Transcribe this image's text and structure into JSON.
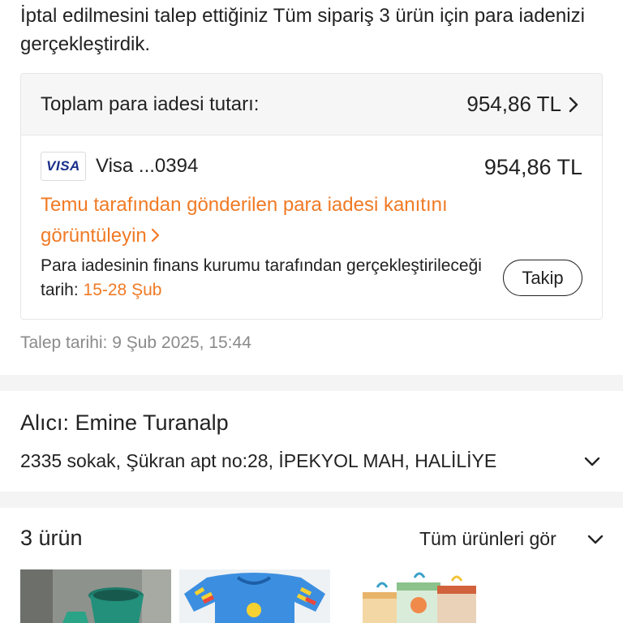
{
  "intro_text": "İptal edilmesini talep ettiğiniz Tüm sipariş 3 ürün için para iadenizi gerçekleştirdik.",
  "refund": {
    "total_label": "Toplam para iadesi tutarı:",
    "total_amount": "954,86 TL",
    "card_logo": "VISA",
    "card_name": "Visa ...0394",
    "card_amount": "954,86 TL",
    "proof_link": "Temu tarafından gönderilen para iadesi kanıtını görüntüleyin",
    "date_text": "Para iadesinin finans kurumu tarafından gerçekleştirileceği tarih:",
    "date_range": "15-28 Şub",
    "track_button": "Takip"
  },
  "request_date": "Talep tarihi: 9 Şub 2025, 15:44",
  "receiver": {
    "label": "Alıcı: Emine Turanalp",
    "address": "2335 sokak, Şükran apt no:28, İPEKYOL MAH, HALİLİYE"
  },
  "items": {
    "count_label": "3 ürün",
    "see_all": "Tüm ürünleri gör"
  },
  "colors": {
    "accent_orange": "#f07a25",
    "visa_blue": "#1a2f8a"
  },
  "icons": [
    "chevron-right-icon",
    "chevron-down-icon",
    "visa-logo"
  ]
}
